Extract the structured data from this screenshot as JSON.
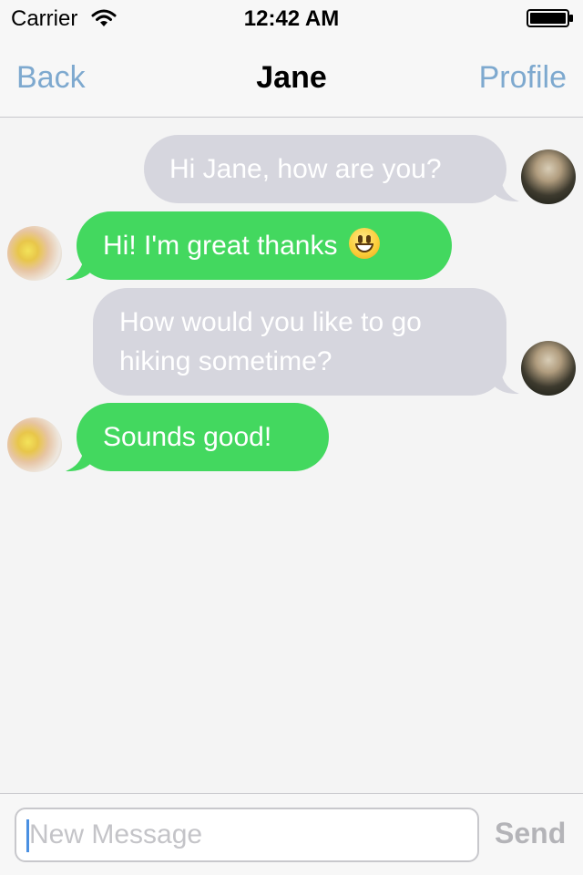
{
  "status_bar": {
    "carrier": "Carrier",
    "time": "12:42 AM",
    "icons": [
      "wifi-icon",
      "battery-icon"
    ]
  },
  "nav": {
    "back_label": "Back",
    "title": "Jane",
    "profile_label": "Profile"
  },
  "messages": [
    {
      "direction": "outgoing",
      "text": "Hi Jane, how are you?"
    },
    {
      "direction": "incoming",
      "text": "Hi! I'm great thanks",
      "emoji": "grinning-face"
    },
    {
      "direction": "outgoing",
      "lines": [
        "How would you like to go",
        "hiking sometime?"
      ]
    },
    {
      "direction": "incoming",
      "text": "Sounds good!"
    }
  ],
  "composer": {
    "placeholder": "New Message",
    "value": "",
    "send_label": "Send"
  },
  "colors": {
    "outgoing_bubble": "#d6d6de",
    "incoming_bubble": "#43d85f",
    "nav_link": "#7ea9cf",
    "send_disabled": "#b4b4b8"
  }
}
